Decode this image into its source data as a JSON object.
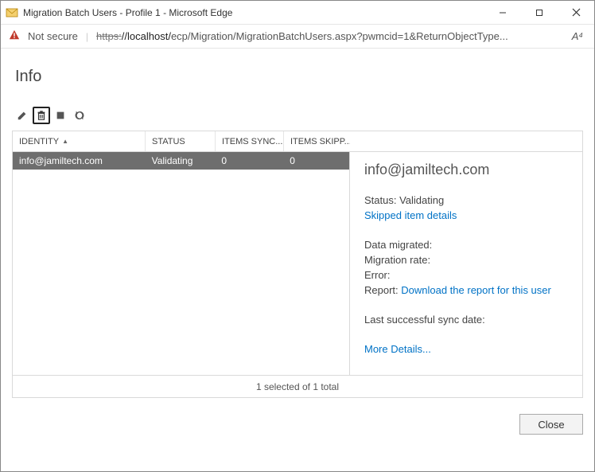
{
  "window": {
    "title": "Migration Batch Users - Profile 1 - Microsoft Edge"
  },
  "addressbar": {
    "not_secure": "Not secure",
    "url_scheme": "https:",
    "url_host": "//localhost/",
    "url_path": "ecp/Migration/MigrationBatchUsers.aspx?pwmcid=1&ReturnObjectType...",
    "reader": "A⁴"
  },
  "page": {
    "title": "Info"
  },
  "columns": {
    "identity": "IDENTITY",
    "status": "STATUS",
    "items_synced": "ITEMS SYNC...",
    "items_skipped": "ITEMS SKIPP..."
  },
  "rows": [
    {
      "identity": "info@jamiltech.com",
      "status": "Validating",
      "items_synced": "0",
      "items_skipped": "0"
    }
  ],
  "footer": {
    "selection": "1 selected of 1 total"
  },
  "details": {
    "title": "info@jamiltech.com",
    "status_label": "Status: ",
    "status_value": "Validating",
    "skipped_link": "Skipped item details",
    "data_migrated": "Data migrated:",
    "migration_rate": "Migration rate:",
    "error": "Error:",
    "report_label": "Report: ",
    "report_link": "Download the report for this user",
    "last_sync": "Last successful sync date:",
    "more_details": "More Details..."
  },
  "buttons": {
    "close": "Close"
  }
}
